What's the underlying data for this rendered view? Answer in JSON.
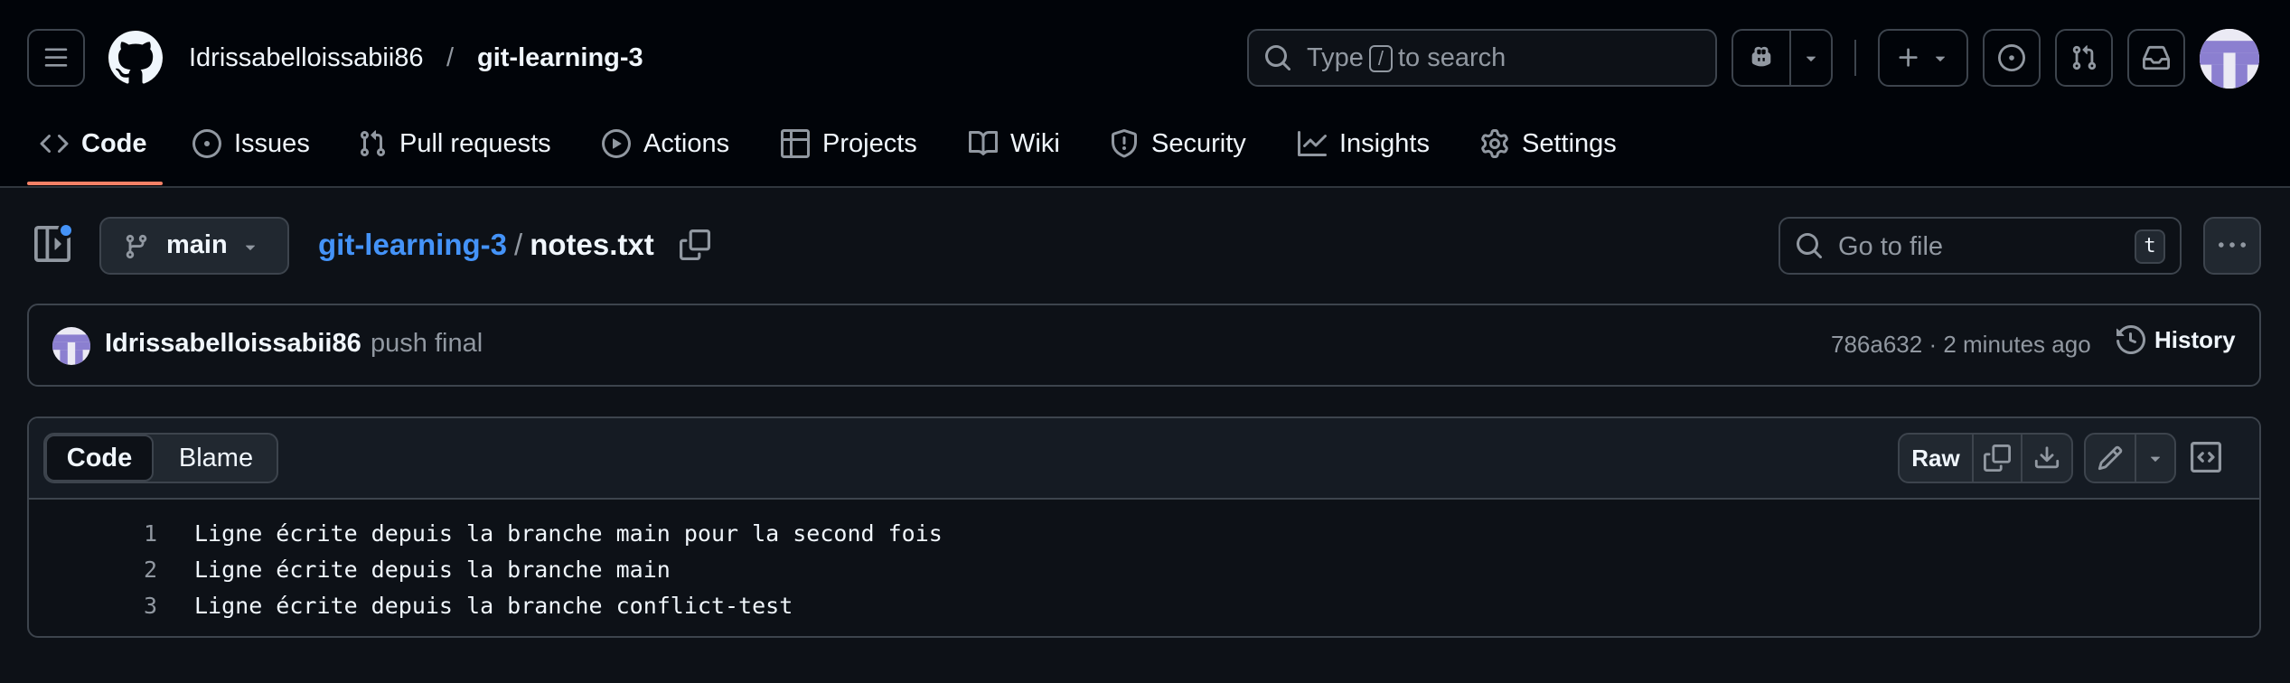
{
  "header": {
    "owner": "Idrissabelloissabii86",
    "separator": "/",
    "repo": "git-learning-3",
    "search_prefix": "Type",
    "search_key": "/",
    "search_suffix": "to search"
  },
  "nav": {
    "tabs": [
      {
        "label": "Code",
        "icon": "code-icon",
        "active": true
      },
      {
        "label": "Issues",
        "icon": "issue-icon"
      },
      {
        "label": "Pull requests",
        "icon": "git-pull-request-icon"
      },
      {
        "label": "Actions",
        "icon": "play-icon"
      },
      {
        "label": "Projects",
        "icon": "table-icon"
      },
      {
        "label": "Wiki",
        "icon": "book-icon"
      },
      {
        "label": "Security",
        "icon": "shield-icon"
      },
      {
        "label": "Insights",
        "icon": "graph-icon"
      },
      {
        "label": "Settings",
        "icon": "gear-icon"
      }
    ],
    "accent": "#f78166"
  },
  "file": {
    "branch": "main",
    "breadcrumb_repo": "git-learning-3",
    "breadcrumb_sep": "/",
    "filename": "notes.txt",
    "goto_placeholder": "Go to file",
    "goto_key": "t"
  },
  "commit": {
    "author": "Idrissabelloissabii86",
    "message": "push final",
    "meta": "786a632 · 2 minutes ago",
    "history_label": "History"
  },
  "viewer": {
    "code_tab": "Code",
    "blame_tab": "Blame",
    "raw_label": "Raw",
    "lines": [
      {
        "num": "1",
        "text": "Ligne écrite depuis la branche main pour la second fois"
      },
      {
        "num": "2",
        "text": "Ligne écrite depuis la branche main"
      },
      {
        "num": "3",
        "text": "Ligne écrite depuis la branche conflict-test"
      }
    ]
  },
  "colors": {
    "background": "#0d1117",
    "header_bg": "#010409",
    "link": "#4493f8",
    "border": "#3d444d",
    "muted": "#9198a1"
  }
}
